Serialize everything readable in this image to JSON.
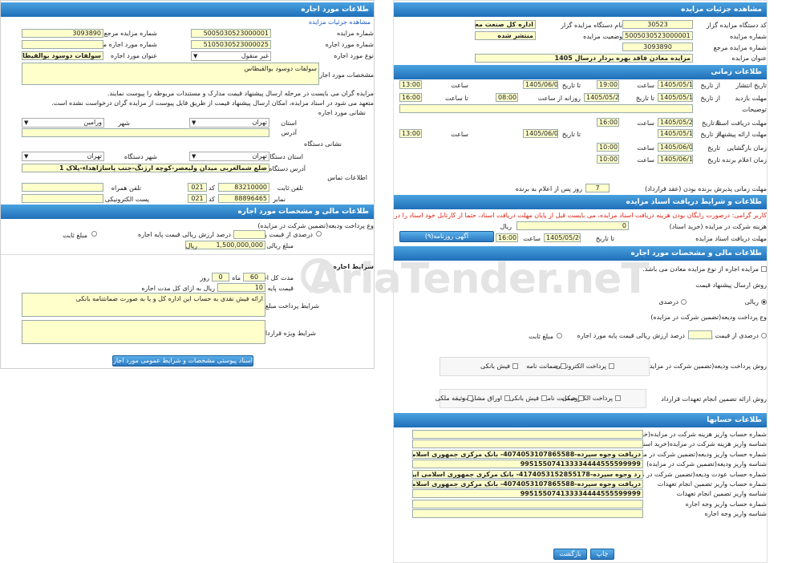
{
  "left": {
    "header": "طلاعات مورد اجاره",
    "view_details_link": "مشاهده جزئیات مزایده",
    "ref_number_label": "شماره مزایده مرجع",
    "ref_number": "3093890",
    "auction_number_label": "شماره مزایده",
    "auction_number": "5005030523000001",
    "ref_lease_number_label": "شماره مورد اجاره مرجع",
    "lease_number_label": "شماره مورد اجاره",
    "lease_number": "5105030523000025",
    "lease_type_label": "نوع مورد اجاره",
    "lease_type": "غیر منقول",
    "lease_title_label": "عنوان مورد اجاره",
    "lease_title": "سولفات دوسود بوالقیطاس",
    "specs_label": "مشخصات مورد اجاره",
    "specs_value": "سولفات دوسود بوالقیطاس",
    "note1": "مزایده گران می بایست در مرحله ارسال پیشنهاد قیمت مدارک و مستندات مربوطه را پیوست نمایند.",
    "note2": "متعهد می شود در اسناد مزایده، امکان ارسال پیشنهاد قیمت از طریق فایل پیوست از مزایده گران درخواست نشده است.",
    "address_section_label": "نشانی مورد اجاره",
    "province_label": "استان",
    "province": "تهران",
    "city_label": "شهر",
    "city": "ورامین",
    "address_label": "آدرس",
    "device_address_label": "نشانی دستگاه",
    "device_province_label": "استان دستگاه",
    "device_province": "تهران",
    "device_city_label": "شهر دستگاه",
    "device_city": "تهران",
    "device_address_field_label": "آدرس دستگاه",
    "device_address": "ضلع شمالغربی میدان ولیعصر-کوچه ارژنگ-جنب پاساژاهداء-پلاک 1",
    "contact_label": "اطلاعات تماس",
    "landline_label": "تلفن ثابت",
    "landline_code_label": "کد",
    "landline_code": "021",
    "landline": "83210000",
    "mobile_label": "تلفن همراه",
    "fax_label": "نمابر",
    "fax_code_label": "کد",
    "fax_code": "021",
    "fax": "88896465",
    "email_label": "پست الکترونیکی",
    "financial_header": "طلاعات مالی و مشخصات مورد اجاره",
    "deposit_type_label": "وع پرداخت ودیعه(تضمین شرکت در مزایده)",
    "percent_base_label": "درصدی از قیمت پایه",
    "percent_base_value_label": "درصد ارزش ریالی قیمت پایه اجاره",
    "fixed_amount_label": "مبلغ ثابت",
    "rial_label": "ریال",
    "deposit_amount_label": "مبلغ ریالی ودیعه",
    "deposit_amount": "1,500,000,000",
    "conditions_header": "شرایط اجاره",
    "duration_label": "مدت کل اجاره",
    "duration_months": "60",
    "months_label": "ماه",
    "duration_days": "0",
    "days_label": "روز",
    "base_price_label": "قیمت پایه اجاره",
    "base_price": "10",
    "base_price_unit": "ریال به ازای کل مدت اجاره",
    "payment_terms_label": "شرایط پرداخت مبلغ اجاره و تضامین آن",
    "payment_terms_value": "ارائه فیش نقدی به حساب این اداره کل و یا به صورت ضمانتنامه بانکی",
    "contract_terms_label": "شرایط ویژه قرارداد",
    "attachments_button": "اسناد پیوستی مشخصات و شرایط عمومی مورد اجاره(۲)"
  },
  "right": {
    "header": "مشاهده جزئیات مزایده",
    "org_code_label": "کد دستگاه مزایده گزار",
    "org_code": "30523",
    "auction_number_label": "شماره مزایده",
    "auction_number": "5005030523000001",
    "ref_number_label": "شماره مزایده مرجع",
    "ref_number": "3093890",
    "title_label": "عنوان مزایده",
    "title": "مزایده معادن فاقد بهره بردار درسال 1405",
    "org_name_label": "نام دستگاه مزایده گزار",
    "org_name": "اداره کل صنعت  معدن و تجا",
    "status_label": "وضعیت مزایده",
    "status": "منتشر شده",
    "time_header": "طلاعات زمانی",
    "publish_label": "تاریخ انتشار",
    "from_label": "از تاریخ",
    "to_label": "تا تاریخ",
    "hour_label": "ساعت",
    "publish_from_date": "1405/05/10",
    "publish_from_time": "19:00",
    "publish_to_date": "1405/06/03",
    "publish_to_time": "13:00",
    "visit_label": "مهلت بازدید",
    "visit_from_date": "1405/05/10",
    "visit_to_date": "1405/05/20",
    "visit_daily_label": "روزانه از ساعت",
    "visit_daily_from": "08:00",
    "visit_daily_to": "16:00",
    "visit_daily_to_label": "تا ساعت",
    "desc_label": "توضیحات",
    "doc_deadline_label": "مهلت دریافت اسناد",
    "doc_deadline_to_label": "تا تاریخ",
    "doc_deadline_date": "1405/05/20",
    "doc_deadline_time": "16:00",
    "bid_deadline_label": "مهلت ارائه پیشنهاد",
    "bid_from_date": "1405/05/10",
    "bid_to_date": "1405/06/03",
    "bid_to_time": "13:00",
    "opening_label": "زمان بازگشایی",
    "date_label": "تاریخ",
    "opening_date": "1405/06/04",
    "opening_time": "10:00",
    "announce_label": "زمان اعلام برنده",
    "announce_date": "1405/06/11",
    "announce_time": "10:00",
    "acceptance_label": "مهلت زمانی پذیرش برنده بودن (عقد قرارداد)",
    "acceptance_days": "7",
    "acceptance_suffix": "روز پس از اعلام به برنده",
    "docs_header": "طلاعات و شرایط دریافت اسناد مزایده",
    "docs_warning": "کاربر گرامی: درصورت رایگان بودن هزینه دریافت اسناد مزایده، می بایست قبل از پایان مهلت دریافت اسناد، حتما از کارتابل خود اسناد را دریافت نمایید.",
    "doc_fee_label": "هزینه شرکت در مزایده (خرید اسناد)",
    "doc_fee": "0",
    "rial_label": "ریال",
    "doc_receive_label": "مهلت دریافت اسناد مزایده",
    "doc_receive_to_label": "تا تاریخ",
    "doc_receive_date": "1405/05/20",
    "doc_receive_time": "16:00",
    "newspaper_button": "آگهی روزنامه(۹)",
    "financial_header": "طلاعات مالی و مشخصات مورد اجاره",
    "multi_item_text": "مزایده اجاره از نوع مزایده معادن می باشد.",
    "bid_method_label": "روش ارسال پیشنهاد قیمت",
    "rial_option": "ریالی",
    "percent_option": "درصدی",
    "deposit_type_label": "وع پرداخت ودیعه(تضمین شرکت در مزایده)",
    "percent_base_label": "درصدی از قیمت پایه",
    "percent_base_value_label": "درصد ارزش ریالی قیمت پایه مورد اجاره",
    "fixed_amount_label": "مبلغ ثابت",
    "deposit_method_label": "روش پرداخت ودیعه(تضمین شرکت در مزایده)",
    "deposit_methods": [
      "پرداخت الکترونیکی",
      "ضمانت نامه",
      "فیش بانکی"
    ],
    "guarantee_method_label": "روش ارائه تضمین انجام تعهدات قرارداد",
    "guarantee_methods": [
      "پرداخت الکترونیکی",
      "ضمانت نامه",
      "فیش بانکی",
      "اوراق مشارکت",
      "وثیقه ملکی"
    ],
    "accounts_header": "طلاعات حسابها",
    "accounts": [
      {
        "label": "شماره حساب واریز هزینه شرکت در مزایده(خرید اسناد)",
        "value": ""
      },
      {
        "label": "شناسه واریز هزینه شرکت در مزایده(خرید اسناد)",
        "value": ""
      },
      {
        "label": "شماره حساب واریز ودیعه(تضمین شرکت در مزایده)",
        "value": "دریافت وجوه سپرده-4074053107865588- بانک مرکزی جمهوری اسلامی ایران شعبه خزانه"
      },
      {
        "label": "شناسه واریز ودیعه(تضمین شرکت در مزایده)",
        "value": "995155074133334444555599999"
      },
      {
        "label": "شماره حساب عودت ودیعه(تضمین شرکت در مزایده)",
        "value": "رد وجوه سپرده-4174053152855178- بانک مرکزی جمهوری اسلامی ایران شعبه خزانه معین"
      },
      {
        "label": "شماره حساب واریز تضمین انجام تعهدات",
        "value": "دریافت وجوه سپرده-4074053107865588- بانک مرکزی جمهوری اسلامی ایران شعبه خزانه"
      },
      {
        "label": "شناسه واریز تضمین انجام تعهدات",
        "value": "995155074133334444555599999"
      },
      {
        "label": "شماره حساب واریز وجه اجاره",
        "value": ""
      },
      {
        "label": "شناسه واریز وجه اجاره",
        "value": ""
      }
    ],
    "print_button": "چاپ",
    "back_button": "بازگشت"
  },
  "watermark": "AriaTender.neT"
}
